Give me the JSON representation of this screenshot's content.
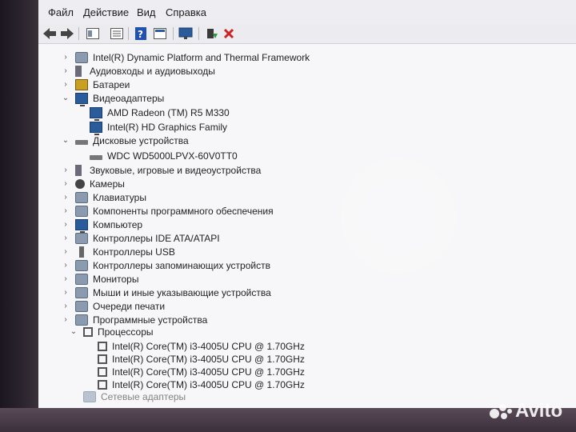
{
  "menu": [
    "Файл",
    "Действие",
    "Вид",
    "Справка"
  ],
  "toolbar": {
    "icons": [
      "back-arrow-icon",
      "forward-arrow-icon",
      "properties-icon",
      "list-icon",
      "help-icon",
      "panel-icon",
      "scan-hardware-icon",
      "update-driver-icon",
      "uninstall-icon"
    ]
  },
  "tree": [
    {
      "label": "Intel(R) Dynamic Platform and Thermal Framework",
      "level": 0,
      "expanded": false,
      "icon": "chip-board-icon"
    },
    {
      "label": "Аудиовходы и аудиовыходы",
      "level": 0,
      "expanded": false,
      "icon": "speaker-icon"
    },
    {
      "label": "Батареи",
      "level": 0,
      "expanded": false,
      "icon": "battery-icon"
    },
    {
      "label": "Видеоадаптеры",
      "level": 0,
      "expanded": true,
      "icon": "monitor-icon"
    },
    {
      "label": "AMD Radeon (TM) R5 M330",
      "level": 1,
      "icon": "monitor-icon"
    },
    {
      "label": "Intel(R) HD Graphics Family",
      "level": 1,
      "icon": "monitor-icon"
    },
    {
      "label": "Дисковые устройства",
      "level": 0,
      "expanded": true,
      "icon": "disk-icon"
    },
    {
      "label": "WDC WD5000LPVX-60V0TT0",
      "level": 1,
      "icon": "disk-icon"
    },
    {
      "label": "Звуковые, игровые и видеоустройства",
      "level": 0,
      "expanded": false,
      "icon": "sound-icon"
    },
    {
      "label": "Камеры",
      "level": 0,
      "expanded": false,
      "icon": "camera-icon"
    },
    {
      "label": "Клавиатуры",
      "level": 0,
      "expanded": false,
      "icon": "keyboard-icon"
    },
    {
      "label": "Компоненты программного обеспечения",
      "level": 0,
      "expanded": false,
      "icon": "software-icon"
    },
    {
      "label": "Компьютер",
      "level": 0,
      "expanded": false,
      "icon": "computer-icon"
    },
    {
      "label": "Контроллеры IDE ATA/ATAPI",
      "level": 0,
      "expanded": false,
      "icon": "ide-icon"
    },
    {
      "label": "Контроллеры USB",
      "level": 0,
      "expanded": false,
      "icon": "usb-icon"
    },
    {
      "label": "Контроллеры запоминающих устройств",
      "level": 0,
      "expanded": false,
      "icon": "storage-icon"
    },
    {
      "label": "Мониторы",
      "level": 0,
      "expanded": false,
      "icon": "monitor-icon"
    },
    {
      "label": "Мыши и иные указывающие устройства",
      "level": 0,
      "expanded": false,
      "icon": "mouse-icon"
    },
    {
      "label": "Очереди печати",
      "level": 0,
      "expanded": false,
      "icon": "printer-icon"
    },
    {
      "label": "Программные устройства",
      "level": 0,
      "expanded": false,
      "icon": "software-device-icon"
    },
    {
      "label": "Процессоры",
      "level": 0,
      "expanded": true,
      "icon": "cpu-icon"
    },
    {
      "label": "Intel(R) Core(TM) i3-4005U CPU @ 1.70GHz",
      "level": 1,
      "icon": "cpu-icon"
    },
    {
      "label": "Intel(R) Core(TM) i3-4005U CPU @ 1.70GHz",
      "level": 1,
      "icon": "cpu-icon"
    },
    {
      "label": "Intel(R) Core(TM) i3-4005U CPU @ 1.70GHz",
      "level": 1,
      "icon": "cpu-icon"
    },
    {
      "label": "Intel(R) Core(TM) i3-4005U CPU @ 1.70GHz",
      "level": 1,
      "icon": "cpu-icon"
    },
    {
      "label": "Сетевые адаптеры",
      "level": 0,
      "expanded": false,
      "icon": "network-icon"
    }
  ],
  "watermark": "Avito",
  "colors": {
    "accent": "#2a5b9a",
    "delete": "#d02020",
    "help": "#2050b0"
  }
}
